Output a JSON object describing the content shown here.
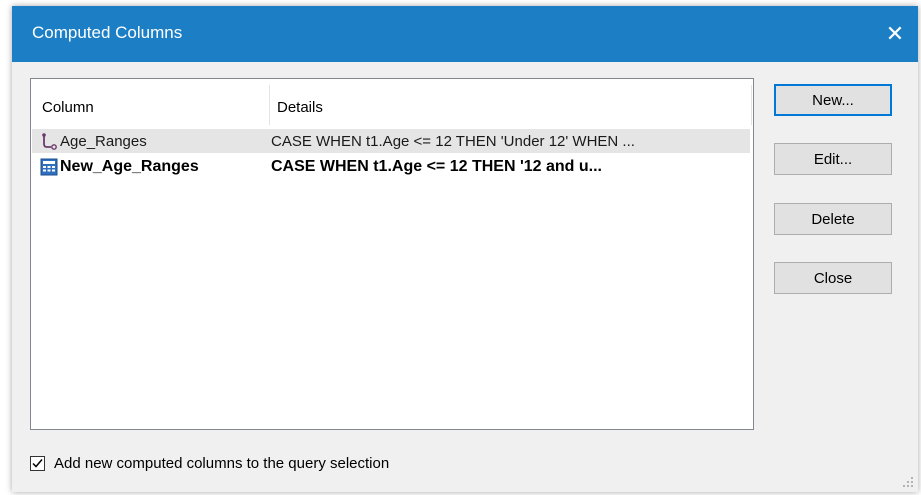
{
  "window": {
    "title": "Computed Columns",
    "close_glyph": "✕",
    "titlebar_color": "#1c7fc6"
  },
  "list": {
    "headers": {
      "column": "Column",
      "details": "Details"
    },
    "rows": [
      {
        "icon": "recode-icon",
        "column": "Age_Ranges",
        "details": "CASE WHEN t1.Age <= 12 THEN 'Under 12' WHEN ...",
        "selected": true,
        "bold": false
      },
      {
        "icon": "calculator-icon",
        "column": "New_Age_Ranges",
        "details": "CASE WHEN t1.Age <= 12 THEN '12 and u...",
        "selected": false,
        "bold": true
      }
    ]
  },
  "buttons": {
    "new": "New...",
    "edit": "Edit...",
    "delete": "Delete",
    "close": "Close"
  },
  "options": {
    "add_to_query_label": "Add new computed columns to the query selection",
    "add_to_query_checked": true
  }
}
